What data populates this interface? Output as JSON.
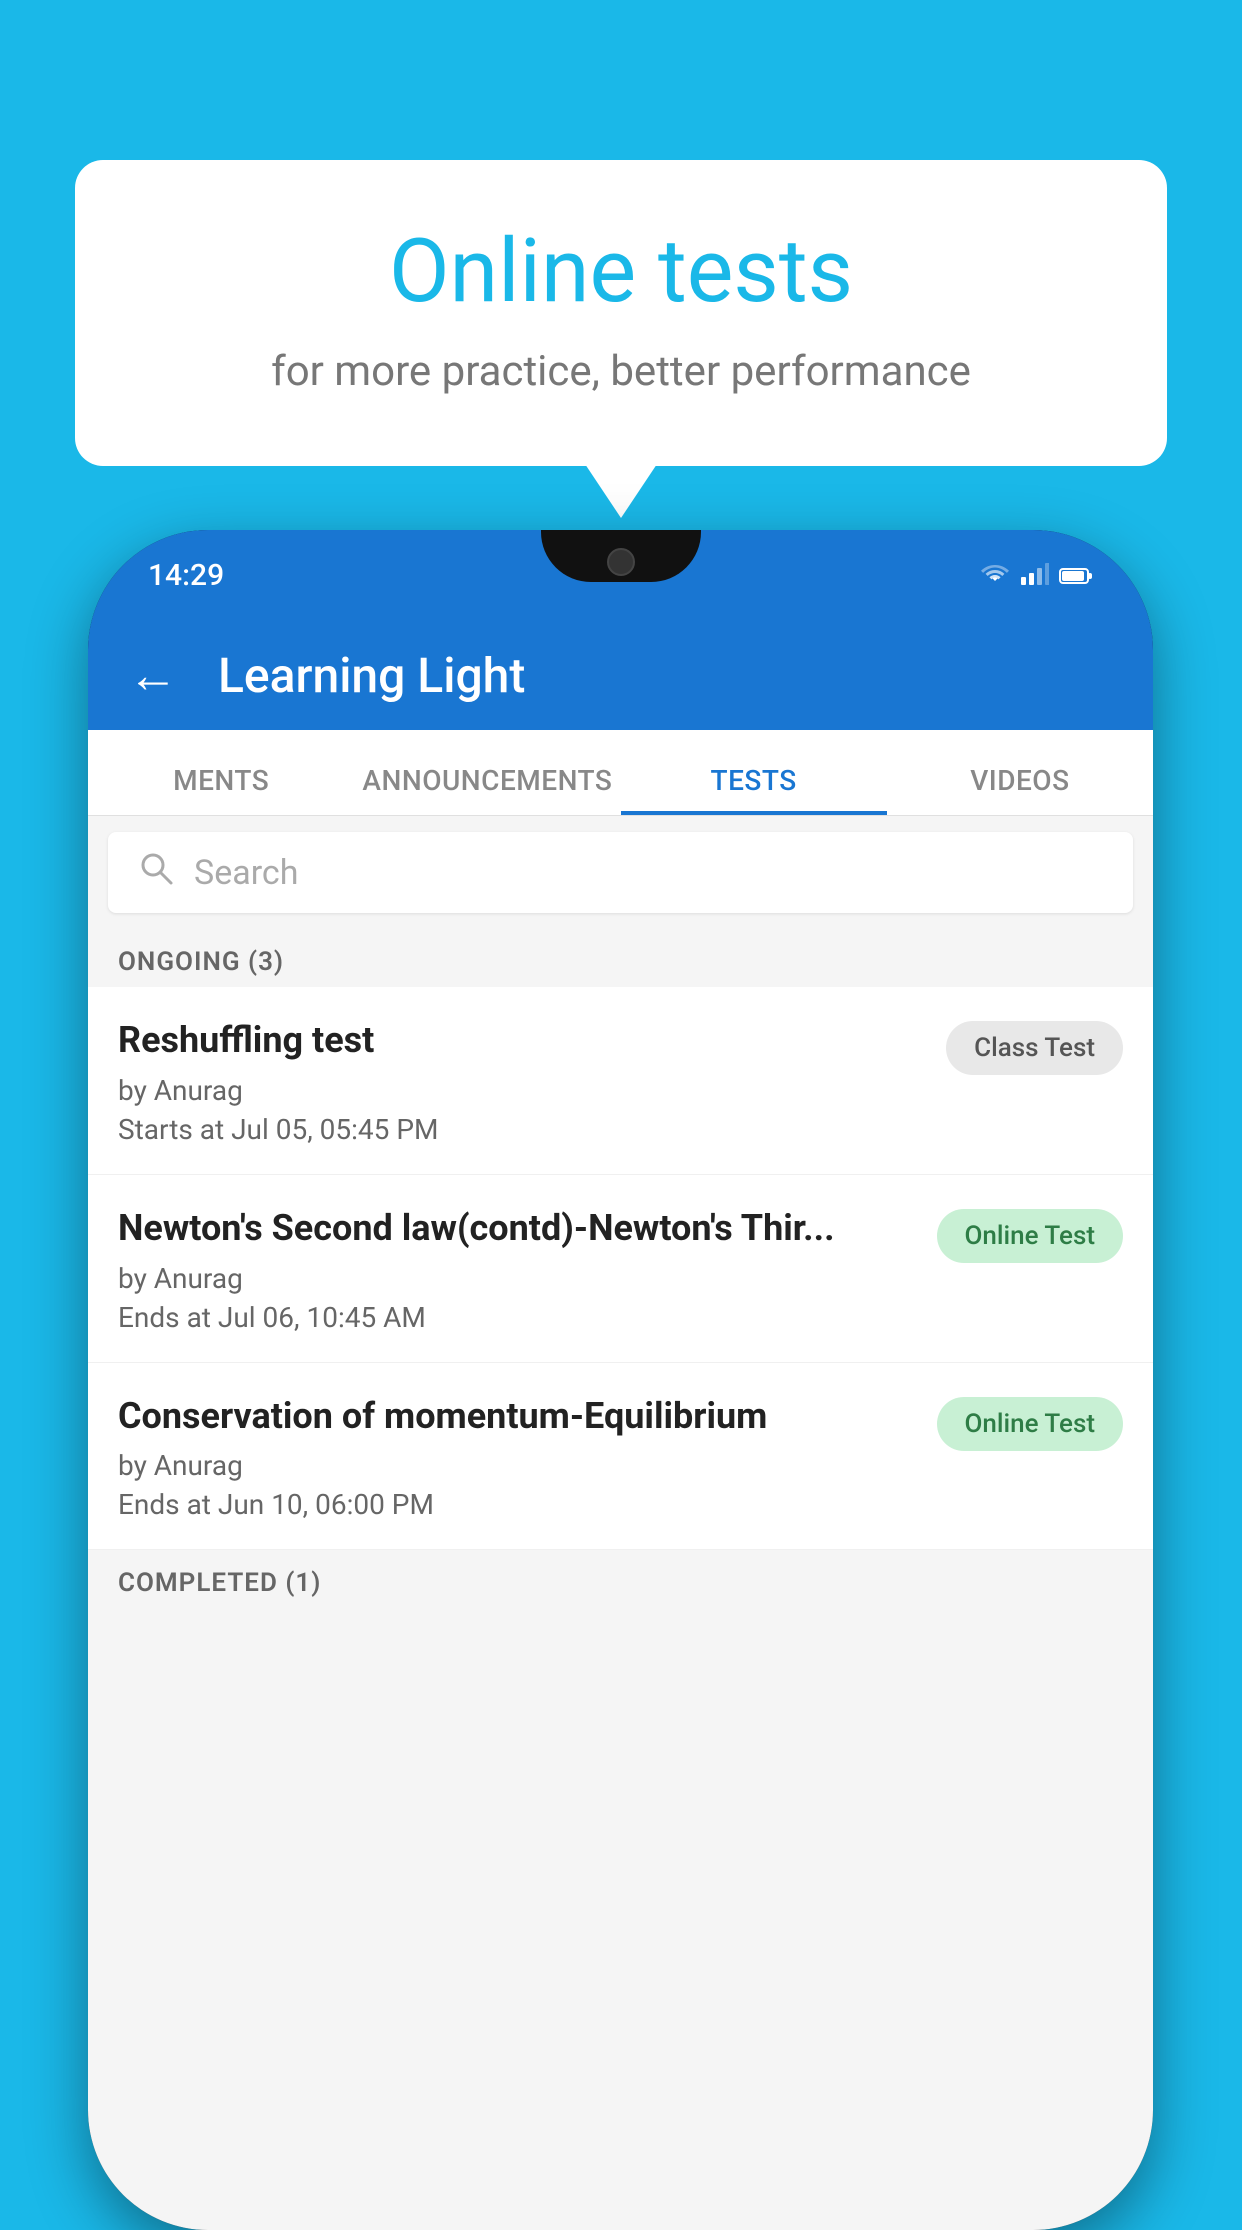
{
  "background_color": "#1ab8e8",
  "bubble": {
    "title": "Online tests",
    "subtitle": "for more practice, better performance"
  },
  "phone": {
    "status_bar": {
      "time": "14:29",
      "icons": [
        "wifi",
        "signal",
        "battery"
      ]
    },
    "header": {
      "back_label": "←",
      "title": "Learning Light"
    },
    "tabs": [
      {
        "label": "MENTS",
        "active": false
      },
      {
        "label": "ANNOUNCEMENTS",
        "active": false
      },
      {
        "label": "TESTS",
        "active": true
      },
      {
        "label": "VIDEOS",
        "active": false
      }
    ],
    "search": {
      "placeholder": "Search",
      "icon": "search"
    },
    "ongoing": {
      "section_label": "ONGOING (3)",
      "tests": [
        {
          "title": "Reshuffling test",
          "by": "by Anurag",
          "date": "Starts at  Jul 05, 05:45 PM",
          "badge": "Class Test",
          "badge_type": "class"
        },
        {
          "title": "Newton's Second law(contd)-Newton's Thir...",
          "by": "by Anurag",
          "date": "Ends at  Jul 06, 10:45 AM",
          "badge": "Online Test",
          "badge_type": "online"
        },
        {
          "title": "Conservation of momentum-Equilibrium",
          "by": "by Anurag",
          "date": "Ends at  Jun 10, 06:00 PM",
          "badge": "Online Test",
          "badge_type": "online"
        }
      ]
    },
    "completed": {
      "section_label": "COMPLETED (1)"
    }
  }
}
